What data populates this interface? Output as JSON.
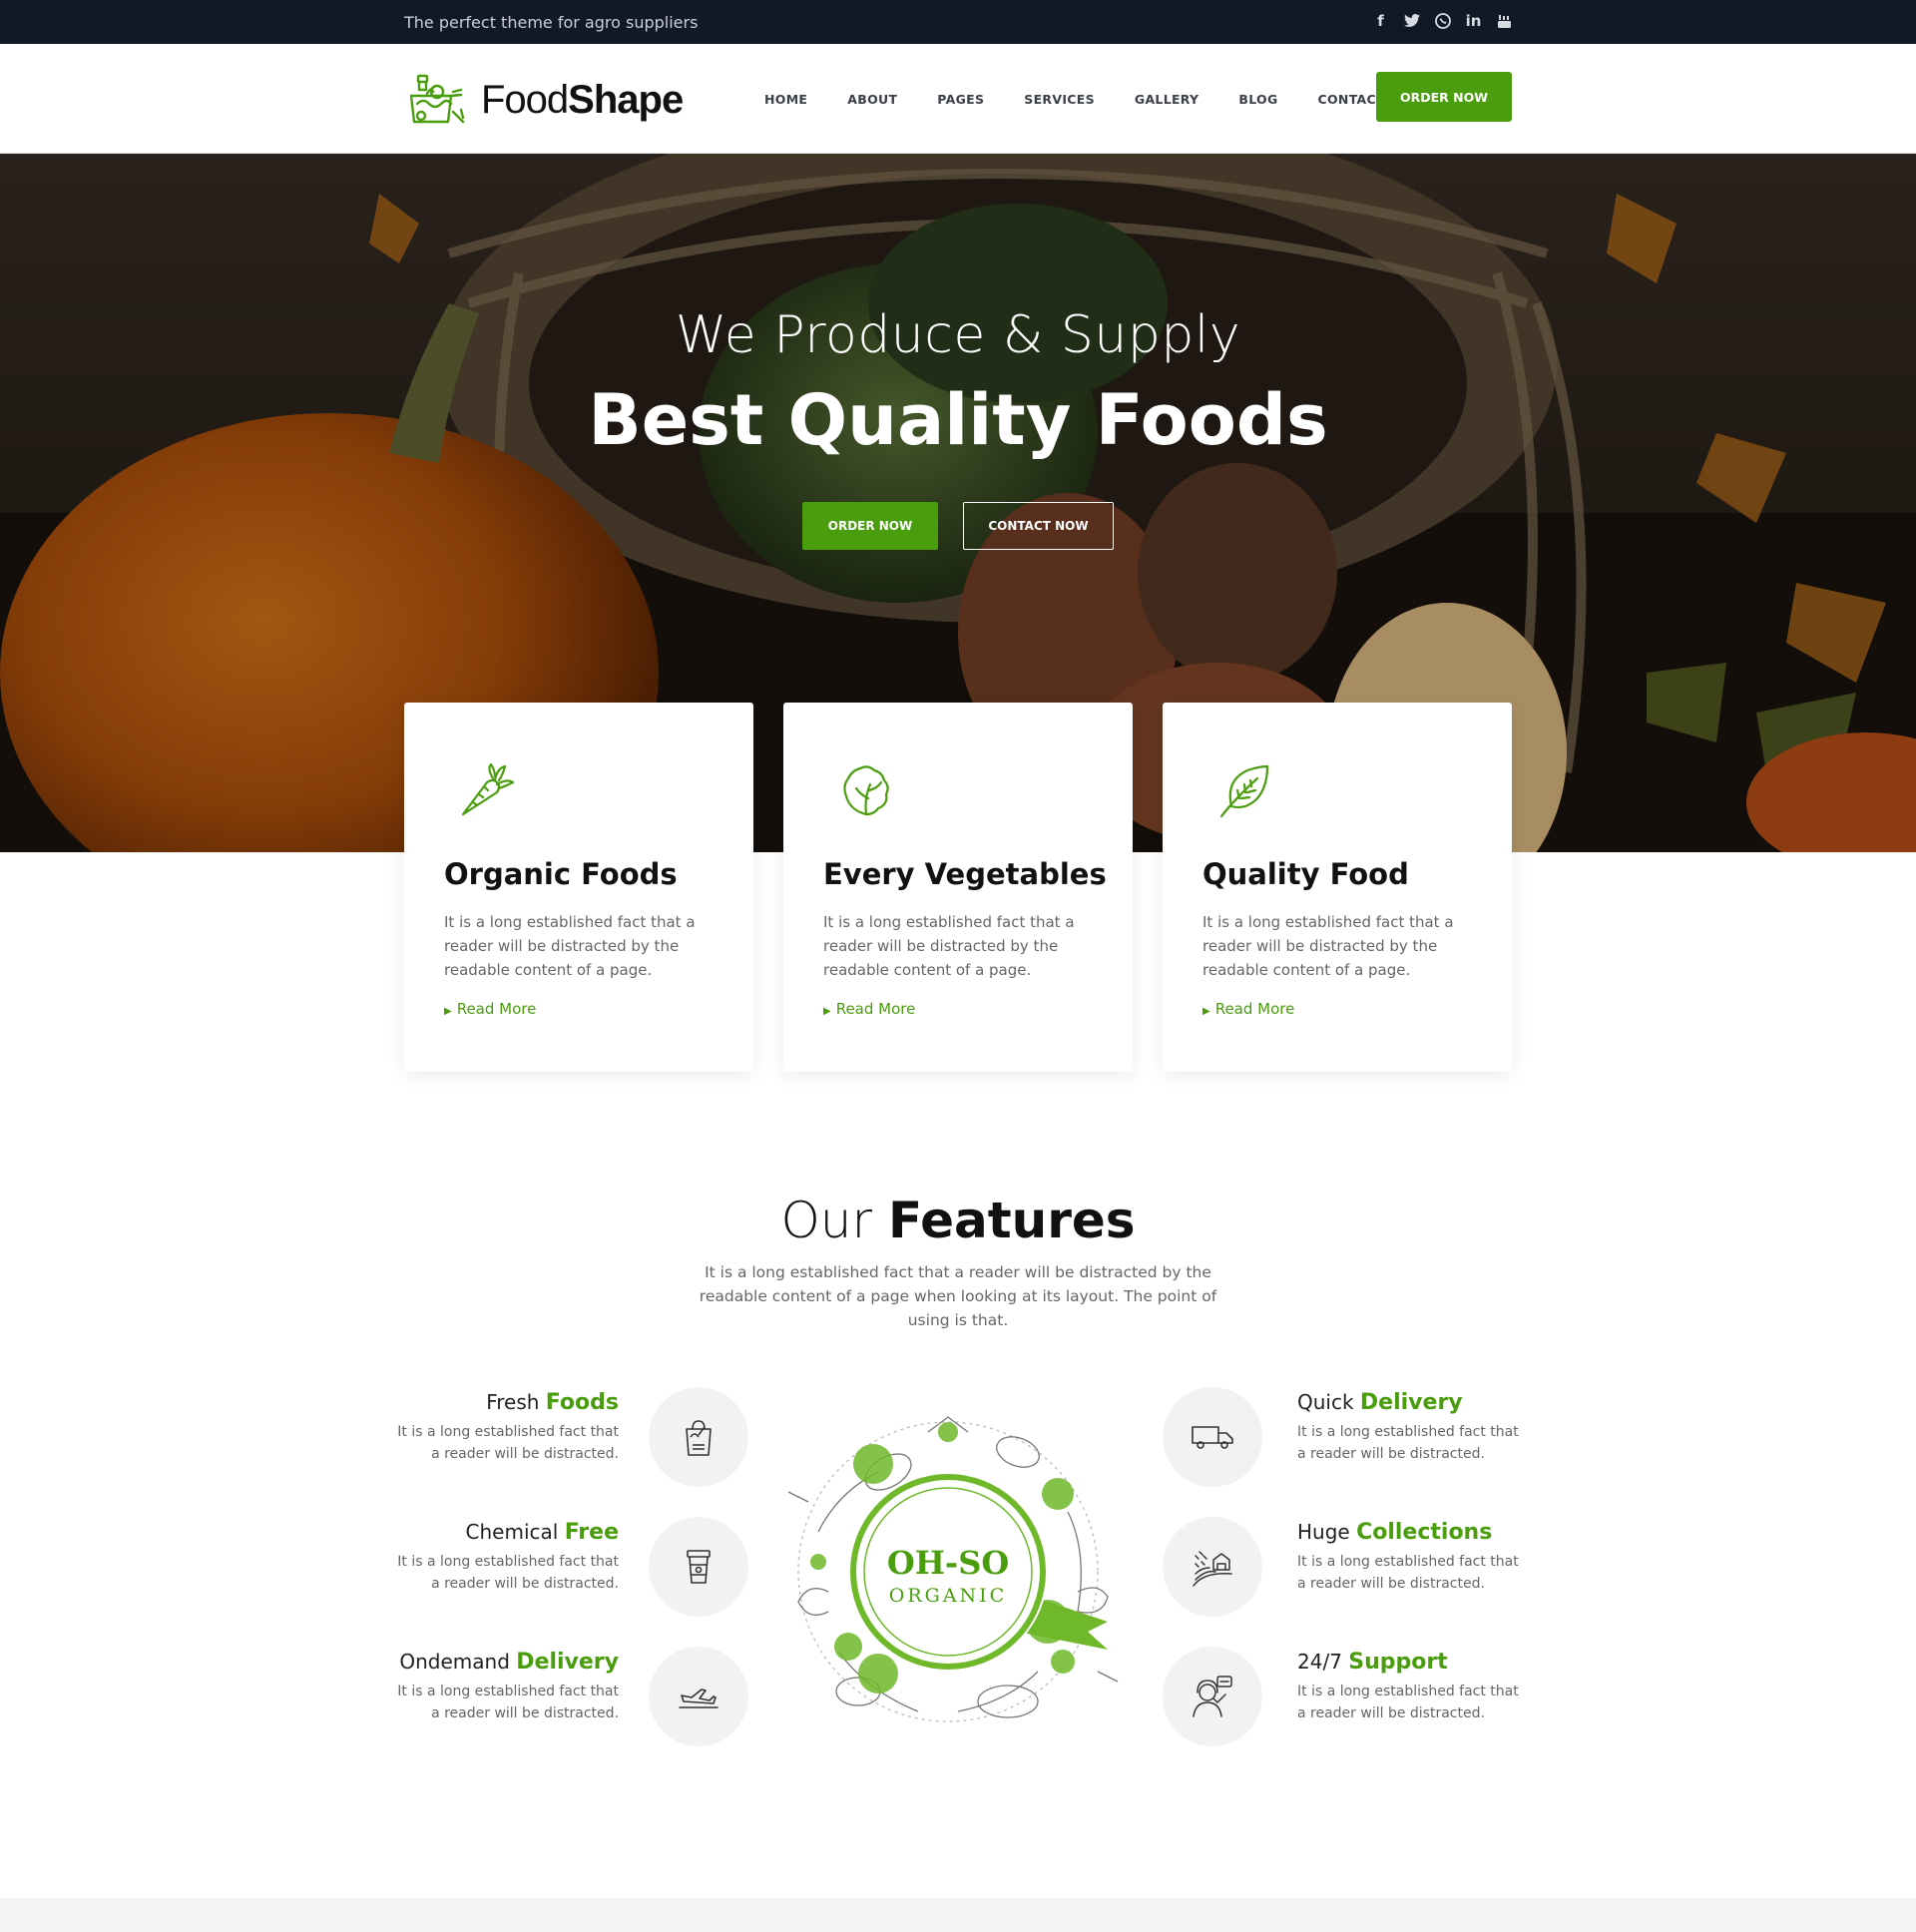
{
  "topbar": {
    "tagline": "The perfect theme for agro suppliers",
    "socials": [
      {
        "icon": "facebook-icon",
        "glyph": "f"
      },
      {
        "icon": "twitter-icon",
        "glyph": "🐦"
      },
      {
        "icon": "whatsapp-icon",
        "glyph": "◉"
      },
      {
        "icon": "linkedin-icon",
        "glyph": "in"
      },
      {
        "icon": "youtube-icon",
        "glyph": "▶"
      }
    ]
  },
  "header": {
    "logo_thin": "Food",
    "logo_bold": "Shape",
    "nav": [
      "HOME",
      "ABOUT",
      "PAGES",
      "SERVICES",
      "GALLERY",
      "BLOG",
      "CONTACT"
    ],
    "order_label": "ORDER NOW",
    "accent": "#4a9e0e"
  },
  "hero": {
    "subtitle": "We Produce & Supply",
    "title": "Best Quality Foods",
    "btn_primary": "ORDER NOW",
    "btn_secondary": "CONTACT NOW"
  },
  "cards": [
    {
      "icon": "carrot-icon",
      "title": "Organic Foods",
      "text": "It is a long established fact that a reader will be distracted by the readable content of a page.",
      "link": "Read More"
    },
    {
      "icon": "lettuce-icon",
      "title": "Every Vegetables",
      "text": "It is a long established fact that a reader will be distracted by the readable content of a page.",
      "link": "Read More"
    },
    {
      "icon": "leaf-icon",
      "title": "Quality Food",
      "text": "It is a long established fact that a reader will be distracted by the readable content of a page.",
      "link": "Read More"
    }
  ],
  "features": {
    "title_light": "Our",
    "title_bold": "Features",
    "desc": "It is a long established fact that a reader will be distracted by the readable content of a page when looking at its layout. The point of using is that.",
    "left": [
      {
        "plain": "Fresh",
        "green": "Foods",
        "text": "It is a long established fact that a reader will be distracted.",
        "icon": "grocery-bag-icon"
      },
      {
        "plain": "Chemical",
        "green": "Free",
        "text": "It is a long established fact that a reader will be distracted.",
        "icon": "cup-icon"
      },
      {
        "plain": "Ondemand",
        "green": "Delivery",
        "text": "It is a long established fact that a reader will be distracted.",
        "icon": "airplane-icon"
      }
    ],
    "right": [
      {
        "plain": "Quick",
        "green": "Delivery",
        "text": "It is a long established fact that a reader will be distracted.",
        "icon": "truck-icon"
      },
      {
        "plain": "Huge",
        "green": "Collections",
        "text": "It is a long established fact that a reader will be distracted.",
        "icon": "farm-icon"
      },
      {
        "plain": "24/7",
        "green": "Support",
        "text": "It is a long established fact that a reader will be distracted.",
        "icon": "support-agent-icon"
      }
    ],
    "badge_top": "OH-SO",
    "badge_bottom": "ORGANIC"
  }
}
